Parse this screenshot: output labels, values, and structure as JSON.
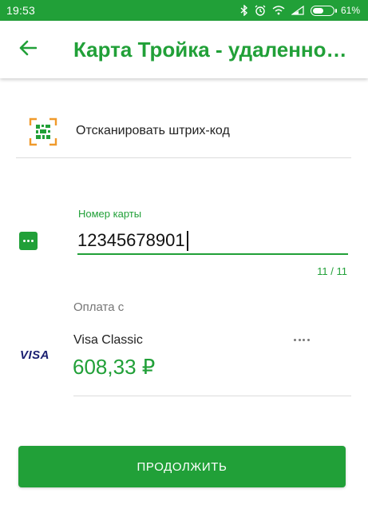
{
  "status_bar": {
    "time": "19:53",
    "battery_percent": "61%",
    "battery_level": 0.61,
    "icons": [
      "bluetooth-icon",
      "alarm-icon",
      "wifi-icon",
      "signal-icon"
    ]
  },
  "app_bar": {
    "title": "Карта Тройка - удаленное п...",
    "back_icon": "arrow-left-icon"
  },
  "scan": {
    "label": "Отсканировать штрих-код",
    "icon": "barcode-scan-icon"
  },
  "card_number": {
    "label": "Номер карты",
    "value": "12345678901",
    "counter": "11 / 11",
    "icon": "card-dots-icon"
  },
  "payment": {
    "label": "Оплата с",
    "card_brand": "VISA",
    "card_name": "Visa Classic",
    "balance": "608,33 ₽",
    "more_icon": "more-dots-icon"
  },
  "continue_button": "ПРОДОЛЖИТЬ",
  "colors": {
    "accent": "#21a038",
    "visa": "#1a1f71",
    "scan_orange": "#f09a2b"
  }
}
